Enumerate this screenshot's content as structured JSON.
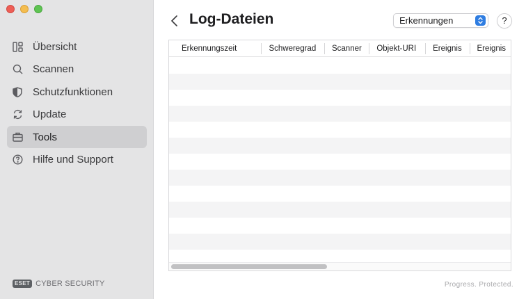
{
  "window": {
    "controls": [
      "close",
      "minimize",
      "zoom"
    ]
  },
  "sidebar": {
    "items": [
      {
        "label": "Übersicht",
        "icon": "overview-icon",
        "active": false
      },
      {
        "label": "Scannen",
        "icon": "search-icon",
        "active": false
      },
      {
        "label": "Schutzfunktionen",
        "icon": "shield-icon",
        "active": false
      },
      {
        "label": "Update",
        "icon": "refresh-icon",
        "active": false
      },
      {
        "label": "Tools",
        "icon": "toolbox-icon",
        "active": true
      },
      {
        "label": "Hilfe und Support",
        "icon": "help-icon",
        "active": false
      }
    ],
    "brand": {
      "logo": "ESET",
      "product": "CYBER SECURITY"
    }
  },
  "main": {
    "title": "Log-Dateien",
    "filter_select": {
      "value": "Erkennungen"
    },
    "help_label": "?",
    "table": {
      "columns": [
        "Erkennungszeit",
        "Schweregrad",
        "Scanner",
        "Objekt-URI",
        "Ereignis",
        "Ereignis"
      ],
      "rows": []
    },
    "tagline": "Progress. Protected."
  },
  "colors": {
    "sidebar_bg": "#e4e4e5",
    "active_item_bg": "#cfcfd1",
    "accent": "#2f7de1",
    "stripe": "#f4f4f5"
  }
}
